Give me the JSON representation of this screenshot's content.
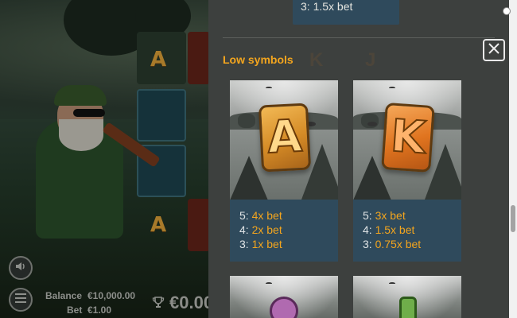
{
  "hud": {
    "balance_label": "Balance",
    "balance_value": "€10,000.00",
    "bet_label": "Bet",
    "bet_value": "€1.00",
    "win_value": "€0.00"
  },
  "background": {
    "reel_letters": [
      "A",
      "A",
      "A"
    ]
  },
  "paytable": {
    "top_card_line": "3: 1.5x bet",
    "section_title": "Low symbols",
    "cards": [
      {
        "symbol": "A",
        "pays": [
          {
            "count": "5:",
            "mult": "4x bet"
          },
          {
            "count": "4:",
            "mult": "2x bet"
          },
          {
            "count": "3:",
            "mult": "1x bet"
          }
        ]
      },
      {
        "symbol": "K",
        "pays": [
          {
            "count": "5:",
            "mult": "3x bet"
          },
          {
            "count": "4:",
            "mult": "1.5x bet"
          },
          {
            "count": "3:",
            "mult": "0.75x bet"
          }
        ]
      }
    ],
    "ghost_letters": [
      "K",
      "J"
    ]
  },
  "colors": {
    "accent": "#f3a51e",
    "card_bg": "#2f4a5c",
    "panel_bg": "#3d403e",
    "pay_text": "#dfe3e5"
  },
  "icons": {
    "close": "close-icon",
    "sound": "speaker-icon",
    "menu": "menu-icon",
    "trophy": "trophy-icon"
  }
}
